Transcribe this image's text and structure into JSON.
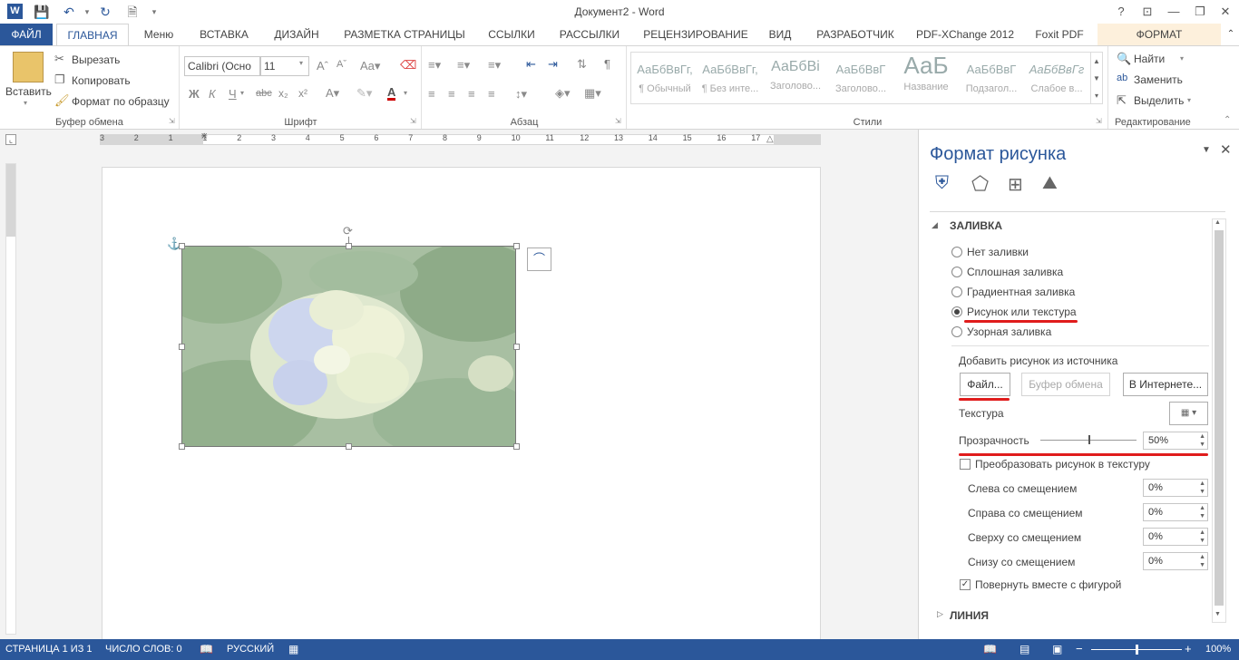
{
  "titlebar": {
    "title": "Документ2 - Word",
    "help": "?",
    "restore_ribbon": "⊡",
    "minimize": "—",
    "maximize": "❐",
    "close": "✕"
  },
  "tabs": [
    "ФАЙЛ",
    "ГЛАВНАЯ",
    "Меню",
    "ВСТАВКА",
    "ДИЗАЙН",
    "РАЗМЕТКА СТРАНИЦЫ",
    "ССЫЛКИ",
    "РАССЫЛКИ",
    "РЕЦЕНЗИРОВАНИЕ",
    "ВИД",
    "РАЗРАБОТЧИК",
    "PDF-XChange 2012",
    "Foxit PDF",
    "ФОРМАТ"
  ],
  "ribbon": {
    "clipboard": {
      "paste": "Вставить",
      "cut": "Вырезать",
      "copy": "Копировать",
      "format_painter": "Формат по образцу",
      "label": "Буфер обмена"
    },
    "font": {
      "name": "Calibri (Осно",
      "size": "11",
      "label": "Шрифт",
      "bold": "Ж",
      "italic": "К",
      "underline": "Ч",
      "strike": "abc",
      "sub": "x₂",
      "sup": "x²"
    },
    "paragraph": {
      "label": "Абзац"
    },
    "styles": {
      "label": "Стили",
      "items": [
        {
          "preview": "АаБбВвГг,",
          "name": "¶ Обычный"
        },
        {
          "preview": "АаБбВвГг,",
          "name": "¶ Без инте..."
        },
        {
          "preview": "АаБбВі",
          "name": "Заголово..."
        },
        {
          "preview": "АаБбВвГ",
          "name": "Заголово..."
        },
        {
          "preview": "АаБ",
          "name": "Название"
        },
        {
          "preview": "АаБбВвГ",
          "name": "Подзагол..."
        },
        {
          "preview": "АаБбВвГг",
          "name": "Слабое в..."
        }
      ]
    },
    "editing": {
      "find": "Найти",
      "replace": "Заменить",
      "select": "Выделить",
      "label": "Редактирование"
    }
  },
  "ruler": {
    "ticks": [
      "3",
      "2",
      "1",
      "1",
      "2",
      "3",
      "4",
      "5",
      "6",
      "7",
      "8",
      "9",
      "10",
      "11",
      "12",
      "13",
      "14",
      "15",
      "16",
      "17"
    ]
  },
  "panel": {
    "title": "Формат рисунка",
    "section_fill": "ЗАЛИВКА",
    "fill_options": [
      "Нет заливки",
      "Сплошная заливка",
      "Градиентная заливка",
      "Рисунок или текстура",
      "Узорная заливка"
    ],
    "selected_fill": 3,
    "insert_from": "Добавить рисунок из источника",
    "btn_file": "Файл...",
    "btn_clipboard": "Буфер обмена",
    "btn_online": "В Интернете...",
    "texture_label": "Текстура",
    "transparency_label": "Прозрачность",
    "transparency_value": "50%",
    "transparency_fraction": 0.5,
    "tile_label": "Преобразовать рисунок в текстуру",
    "offsets": [
      {
        "label": "Слева со смещением",
        "value": "0%"
      },
      {
        "label": "Справа со смещением",
        "value": "0%"
      },
      {
        "label": "Сверху со смещением",
        "value": "0%"
      },
      {
        "label": "Снизу со смещением",
        "value": "0%"
      }
    ],
    "rotate_label": "Повернуть вместе с фигурой",
    "section_line": "ЛИНИЯ"
  },
  "status": {
    "page": "СТРАНИЦА 1 ИЗ 1",
    "words": "ЧИСЛО СЛОВ: 0",
    "lang": "РУССКИЙ",
    "zoom": "100%"
  },
  "colors": {
    "accent": "#2b579a",
    "annotation_red": "#e01c1c",
    "format_tab_bg": "#fdf0dc"
  }
}
